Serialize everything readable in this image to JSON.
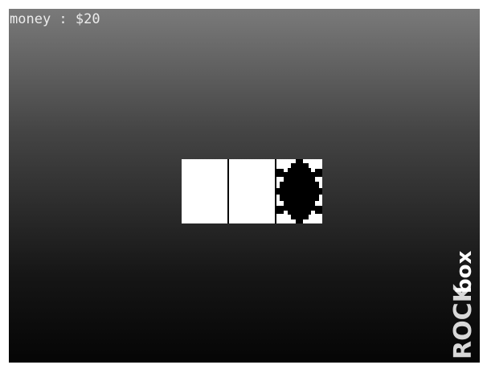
{
  "hud": {
    "money_text": "money : $20"
  },
  "reels": [
    {
      "symbol": "blank"
    },
    {
      "symbol": "blank"
    },
    {
      "symbol": "black-gear"
    }
  ],
  "logo": {
    "text_a": "ROCK",
    "text_b": "box"
  },
  "colors": {
    "text": "#ececec",
    "reel_bg": "#ffffff",
    "reel_symbol": "#000000"
  }
}
